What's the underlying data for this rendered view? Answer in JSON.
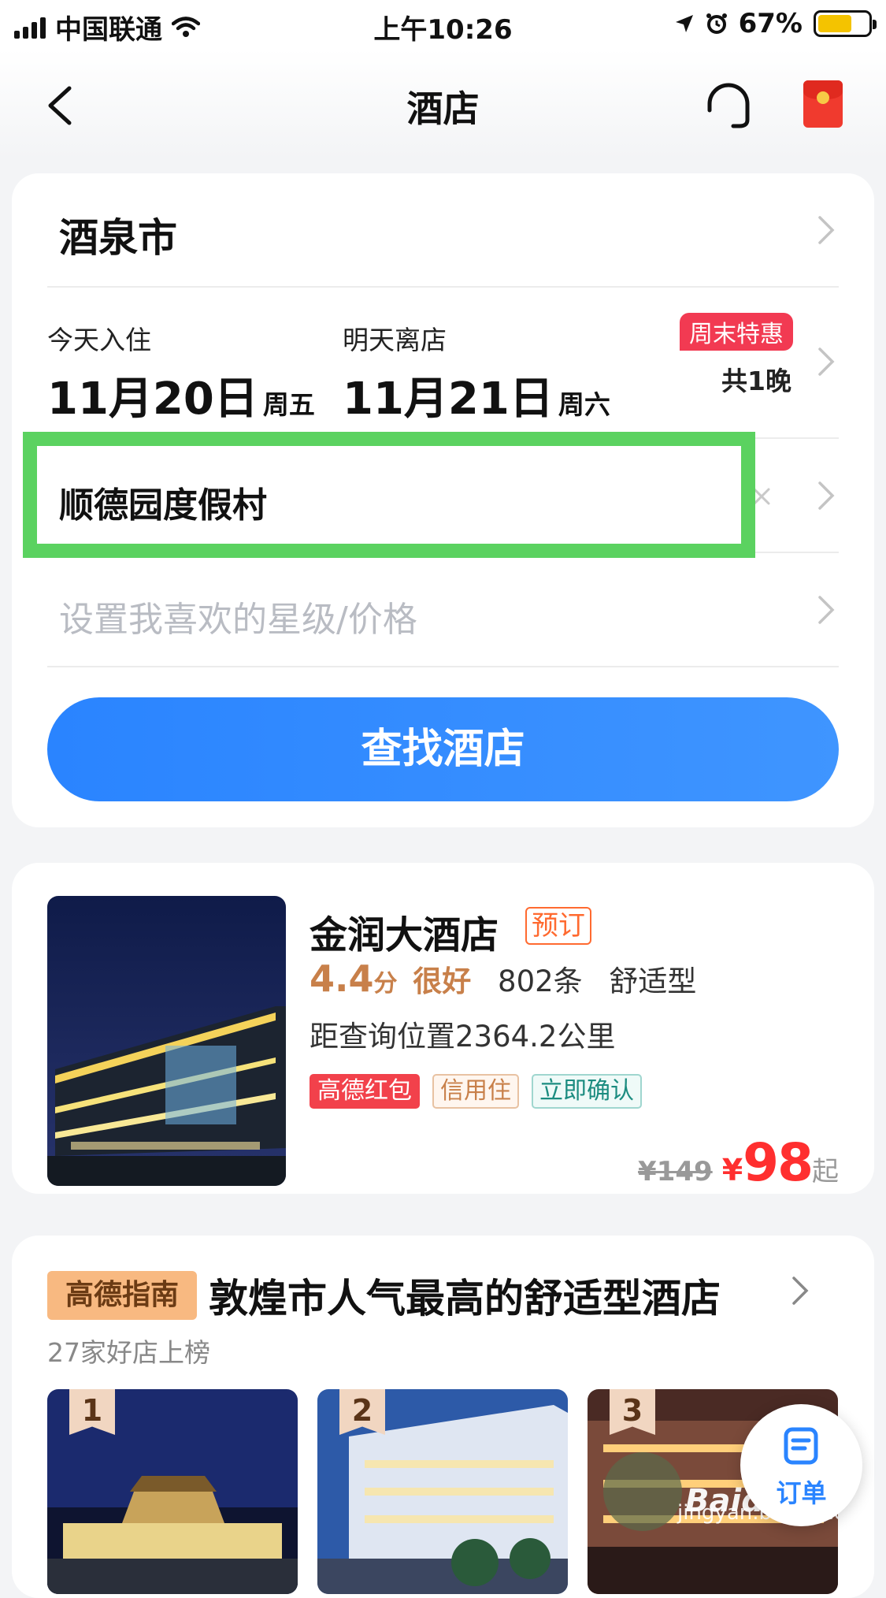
{
  "status_bar": {
    "carrier": "中国联通",
    "time": "上午10:26",
    "battery_percent": "67%",
    "battery_level": 0.67
  },
  "header": {
    "title": "酒店"
  },
  "search": {
    "city": "酒泉市",
    "checkin_label": "今天入住",
    "checkin_date": "11月20日",
    "checkin_weekday": "周五",
    "checkout_label": "明天离店",
    "checkout_date": "11月21日",
    "checkout_weekday": "周六",
    "promo_badge": "周末特惠",
    "nights": "共1晚",
    "keyword": "顺德园度假村",
    "preference_placeholder": "设置我喜欢的星级/价格",
    "search_button": "查找酒店"
  },
  "hotel": {
    "name": "金润大酒店",
    "book_tag": "预订",
    "score": "4.4",
    "score_unit": "分",
    "rating_word": "很好",
    "reviews": "802条",
    "category": "舒适型",
    "distance": "距查询位置2364.2公里",
    "tags": [
      {
        "label": "高德红包",
        "color": "#ffffff",
        "bg": "#f2414b",
        "border": "#f2414b"
      },
      {
        "label": "信用住",
        "color": "#c8804a",
        "bg": "#fff6ef",
        "border": "#e8c2a2"
      },
      {
        "label": "立即确认",
        "color": "#1c8c80",
        "bg": "#effaf8",
        "border": "#9fd6cf"
      }
    ],
    "price_old": "¥149",
    "price_symbol": "¥",
    "price_now": "98",
    "price_suffix": "起"
  },
  "guide": {
    "logo": "高德指南",
    "title": "敦煌市人气最高的舒适型酒店",
    "subtitle": "27家好店上榜",
    "ranks": [
      "1",
      "2",
      "3"
    ]
  },
  "fab": {
    "label": "订单"
  },
  "watermark": {
    "logo": "Baidu经验",
    "url": "jingyan.baidu.com"
  },
  "colors": {
    "accent": "#2a84ff",
    "highlight": "#5bd260",
    "price": "#ff2f2f"
  }
}
